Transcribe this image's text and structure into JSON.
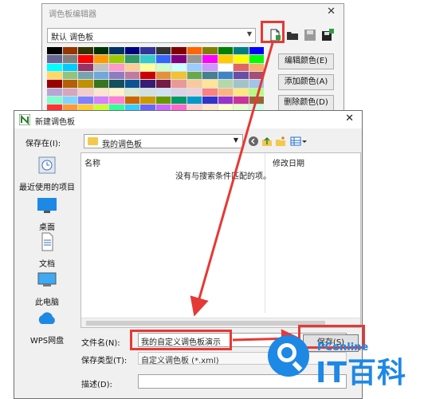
{
  "palette_dialog": {
    "title": "调色板编辑器",
    "close_glyph": "✕",
    "scheme": "默认 调色板",
    "edit_button": "编辑颜色(E)",
    "add_button": "添加颜色(A)",
    "delete_button": "删除颜色(D)",
    "tools": [
      "new-palette-icon",
      "open-folder-icon",
      "save-icon",
      "save-as-icon"
    ],
    "swatches": [
      "#000000",
      "#993300",
      "#333300",
      "#003300",
      "#003366",
      "#000080",
      "#333399",
      "#333333",
      "#800000",
      "#ff6600",
      "#808000",
      "#008000",
      "#008080",
      "#0000ff",
      "#666699",
      "#808080",
      "#ff0000",
      "#ff9900",
      "#99cc00",
      "#339966",
      "#33cccc",
      "#3366ff",
      "#800080",
      "#969696",
      "#ff00ff",
      "#ffcc00",
      "#ffff00",
      "#00ff00",
      "#00ffff",
      "#00ccff",
      "#993366",
      "#c0c0c0",
      "#ff99cc",
      "#ffcc99",
      "#ffff99",
      "#ccffcc",
      "#ccffff",
      "#99ccff",
      "#cc99ff",
      "#ffffff",
      "#e06666",
      "#f6b26b",
      "#ffd966",
      "#93c47d",
      "#76a5af",
      "#6fa8dc",
      "#8e7cc3",
      "#c27ba0",
      "#cc0000",
      "#e69138",
      "#f1c232",
      "#6aa84f",
      "#45818e",
      "#3d85c6",
      "#674ea7",
      "#a64d79",
      "#990000",
      "#b45f06",
      "#bf9000",
      "#38761d",
      "#134f5c",
      "#0b5394",
      "#351c75",
      "#741b47",
      "#ea9999",
      "#f9cb9c",
      "#ffe599",
      "#b6d7a8",
      "#a2c4c9",
      "#9fc5e8",
      "#b4a7d6",
      "#d5a6bd",
      "#f4cccc",
      "#fce5cd",
      "#fff2cc",
      "#d9ead3",
      "#d0e0e3",
      "#cfe2f3",
      "#d9d2e9",
      "#ead1dc",
      "#ff8080",
      "#ffb380",
      "#ffe680",
      "#b3ff80",
      "#80ffcc",
      "#80d4ff",
      "#8080ff",
      "#d580ff",
      "#ff80d4",
      "#cc6600",
      "#cc9900",
      "#669900",
      "#009966",
      "#0099cc",
      "#3333cc",
      "#9933cc",
      "#cc3399",
      "#996633",
      "#ff3333",
      "#ff9933",
      "#ffcc33",
      "#ccff33",
      "#33ff99",
      "#33ccff",
      "#6666ff",
      "#cc66ff",
      "#ff66cc",
      "#ffcccc",
      "#ffe5cc",
      "#ffffcc",
      "#e5ffcc",
      "#ccffe5",
      "#ccf2ff",
      "#ccccff",
      "#f2ccff",
      "#ffccf2",
      "#ff4d4d",
      "#ff8c1a",
      "#ffd11a",
      "#b3ff1a",
      "#1aff8c",
      "#1ad1ff",
      "#4d4dff",
      "#a61aff",
      "#ff1aa6",
      "#e0b080"
    ]
  },
  "save_dialog": {
    "title": "新建调色板",
    "close_glyph": "✕",
    "save_in_label": "保存在(I):",
    "location": "我的调色板",
    "places": [
      {
        "label": "最近使用的项目"
      },
      {
        "label": "桌面"
      },
      {
        "label": "文档"
      },
      {
        "label": "此电脑"
      },
      {
        "label": "WPS网盘"
      }
    ],
    "columns": {
      "name": "名称",
      "date": "修改日期"
    },
    "empty_message": "没有与搜索条件匹配的项。",
    "filename_label": "文件名(N):",
    "filename_value": "我的自定义调色板演示",
    "filetype_label": "保存类型(T):",
    "filetype_value": "自定义调色板 (*.xml)",
    "description_label": "描述(D):",
    "save_button": "保存(S)"
  },
  "annotation_color": "#e53935",
  "watermark": {
    "brand": "PConline",
    "big_text": "IT百科"
  }
}
